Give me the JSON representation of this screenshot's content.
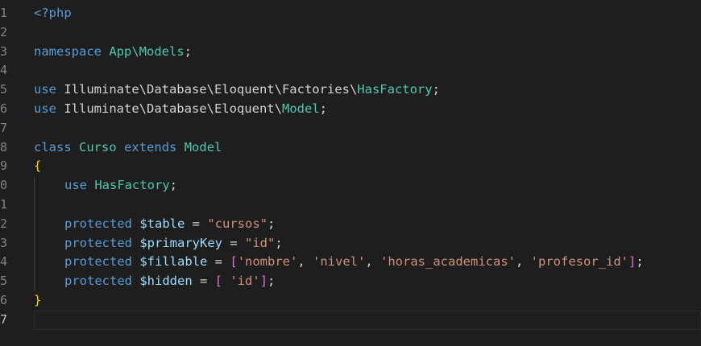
{
  "top_fragment": "· · · · · · ·",
  "line_numbers": [
    "1",
    "2",
    "3",
    "4",
    "5",
    "6",
    "7",
    "8",
    "9",
    "0",
    "1",
    "2",
    "3",
    "4",
    "5",
    "6",
    "7"
  ],
  "colors": {
    "background": "#1e1e1e",
    "keyword": "#569cd6",
    "class_name": "#4ec9b0",
    "variable": "#9cdcfe",
    "string": "#ce9178",
    "brace": "#ffd700",
    "bracket": "#da70d6"
  },
  "code": {
    "l1": {
      "open_tag": "<?php"
    },
    "l3": {
      "keyword": "namespace",
      "space": " ",
      "name": "App\\Models",
      "semi": ";"
    },
    "l5": {
      "keyword": "use",
      "path": " Illuminate\\Database\\Eloquent\\Factories\\",
      "cls": "HasFactory",
      "semi": ";"
    },
    "l6": {
      "keyword": "use",
      "path": " Illuminate\\Database\\Eloquent\\",
      "cls": "Model",
      "semi": ";"
    },
    "l8": {
      "kw_class": "class",
      "sp1": " ",
      "name": "Curso",
      "sp2": " ",
      "kw_extends": "extends",
      "sp3": " ",
      "parent": "Model"
    },
    "l9": {
      "brace": "{"
    },
    "l10": {
      "keyword": "use",
      "sp": " ",
      "cls": "HasFactory",
      "semi": ";"
    },
    "l12": {
      "keyword": "protected",
      "sp": " ",
      "var": "$table",
      "op": " = ",
      "str": "\"cursos\"",
      "semi": ";"
    },
    "l13": {
      "keyword": "protected",
      "sp": " ",
      "var": "$primaryKey",
      "op": " = ",
      "str": "\"id\"",
      "semi": ";"
    },
    "l14": {
      "keyword": "protected",
      "sp": " ",
      "var": "$fillable",
      "op": " = ",
      "open": "[",
      "s1": "'nombre'",
      "c1": ", ",
      "s2": "'nivel'",
      "c2": ", ",
      "s3": "'horas_academicas'",
      "c3": ", ",
      "s4": "'profesor_id'",
      "close": "]",
      "semi": ";"
    },
    "l15": {
      "keyword": "protected",
      "sp": " ",
      "var": "$hidden",
      "op": " = ",
      "open": "[",
      "s1": " 'id'",
      "close": "]",
      "semi": ";"
    },
    "l16": {
      "brace": "}"
    }
  }
}
